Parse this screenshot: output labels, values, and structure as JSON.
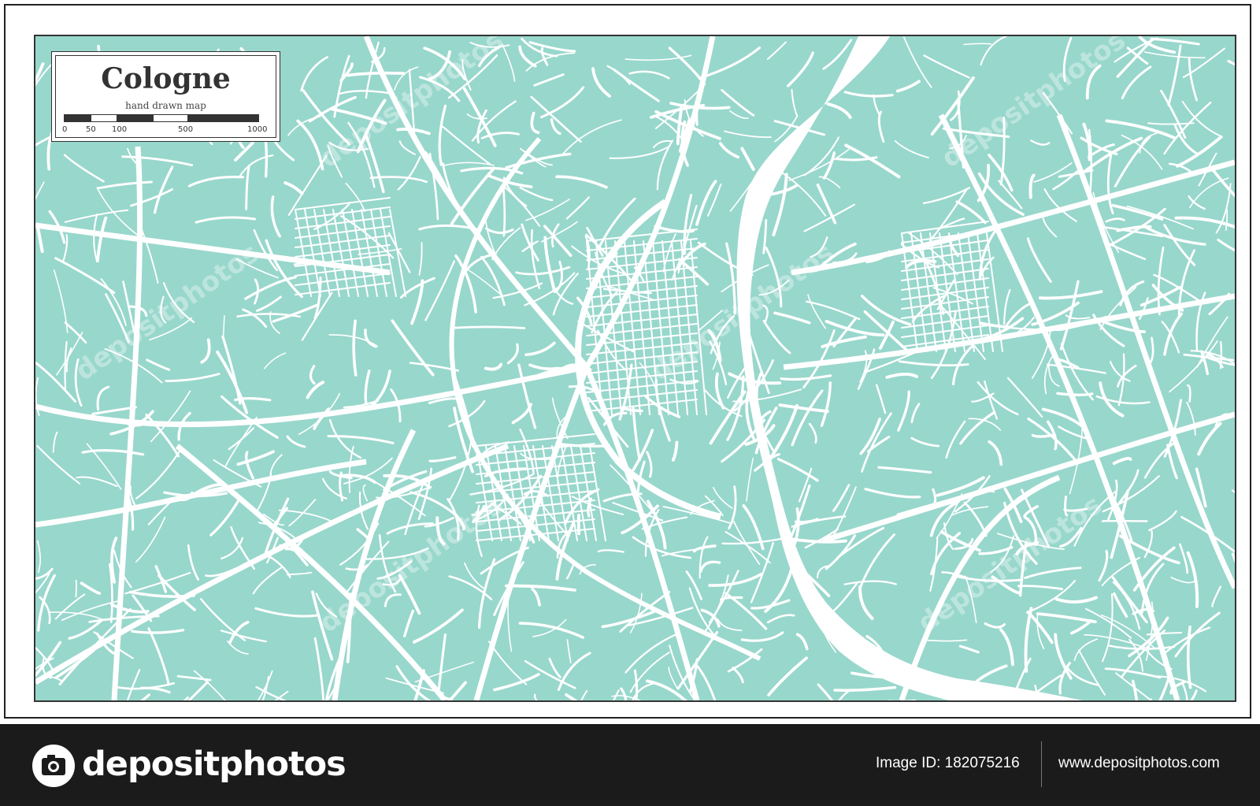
{
  "map": {
    "title": "Cologne",
    "subtitle": "hand drawn map",
    "scale_labels": [
      "0",
      "50",
      "100",
      "500",
      "1000"
    ],
    "colors": {
      "land": "#98d7cc",
      "roads": "#ffffff",
      "river": "#ffffff",
      "frame": "#333333"
    }
  },
  "watermark": {
    "text": "depositphotos"
  },
  "footer": {
    "logo_text": "depositphotos",
    "image_id_text": "Image ID: 182075216",
    "site_text": "www.depositphotos.com",
    "logo_icon": "camera-icon"
  }
}
